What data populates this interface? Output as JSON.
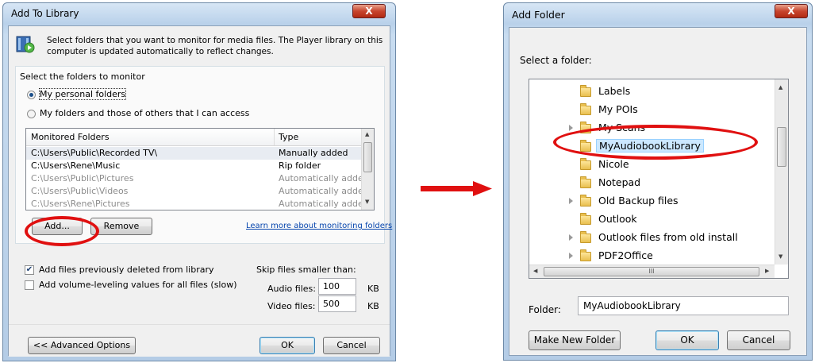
{
  "left_dialog": {
    "title": "Add To Library",
    "close_label": "X",
    "intro_text": "Select folders that you want to monitor for media files. The Player library on this computer is updated automatically to reflect changes.",
    "group_label": "Select the folders to monitor",
    "radio_personal": "My personal folders",
    "radio_all": "My folders and those of others that I can access",
    "list_headers": [
      "Monitored Folders",
      "Type"
    ],
    "rows": [
      {
        "folder": "C:\\Users\\Public\\Recorded TV\\",
        "type": "Manually added",
        "grey": false
      },
      {
        "folder": "C:\\Users\\Rene\\Music",
        "type": "Rip folder",
        "grey": false
      },
      {
        "folder": "C:\\Users\\Public\\Pictures",
        "type": "Automatically added",
        "grey": true
      },
      {
        "folder": "C:\\Users\\Public\\Videos",
        "type": "Automatically added",
        "grey": true
      },
      {
        "folder": "C:\\Users\\Rene\\Pictures",
        "type": "Automatically added",
        "grey": true
      }
    ],
    "add_button": "Add...",
    "remove_button": "Remove",
    "learn_more_link": "Learn more about monitoring folders",
    "check_deleted": "Add files previously deleted from library",
    "check_volume": "Add volume-leveling values for all files (slow)",
    "skip_label": "Skip files smaller than:",
    "audio_label": "Audio files:",
    "audio_value": "100",
    "video_label": "Video files:",
    "video_value": "500",
    "kb_label": "KB",
    "advanced_button": "<< Advanced Options",
    "ok_button": "OK",
    "cancel_button": "Cancel"
  },
  "right_dialog": {
    "title": "Add Folder",
    "close_label": "X",
    "prompt": "Select a folder:",
    "tree_items": [
      {
        "label": "Labels",
        "expander": false,
        "selected": false
      },
      {
        "label": "My POIs",
        "expander": false,
        "selected": false
      },
      {
        "label": "My Scans",
        "expander": true,
        "selected": false
      },
      {
        "label": "MyAudiobookLibrary",
        "expander": false,
        "selected": true
      },
      {
        "label": "Nicole",
        "expander": false,
        "selected": false
      },
      {
        "label": "Notepad",
        "expander": false,
        "selected": false
      },
      {
        "label": "Old Backup files",
        "expander": true,
        "selected": false
      },
      {
        "label": "Outlook",
        "expander": false,
        "selected": false
      },
      {
        "label": "Outlook files from old install",
        "expander": true,
        "selected": false
      },
      {
        "label": "PDF2Office",
        "expander": true,
        "selected": false
      }
    ],
    "hscroll_grip": "III",
    "folder_label": "Folder:",
    "folder_value": "MyAudiobookLibrary",
    "make_new_folder_button": "Make New Folder",
    "ok_button": "OK",
    "cancel_button": "Cancel"
  },
  "colors": {
    "highlight": "#e01010",
    "selection": "#cce8ff",
    "link": "#0645ad"
  }
}
